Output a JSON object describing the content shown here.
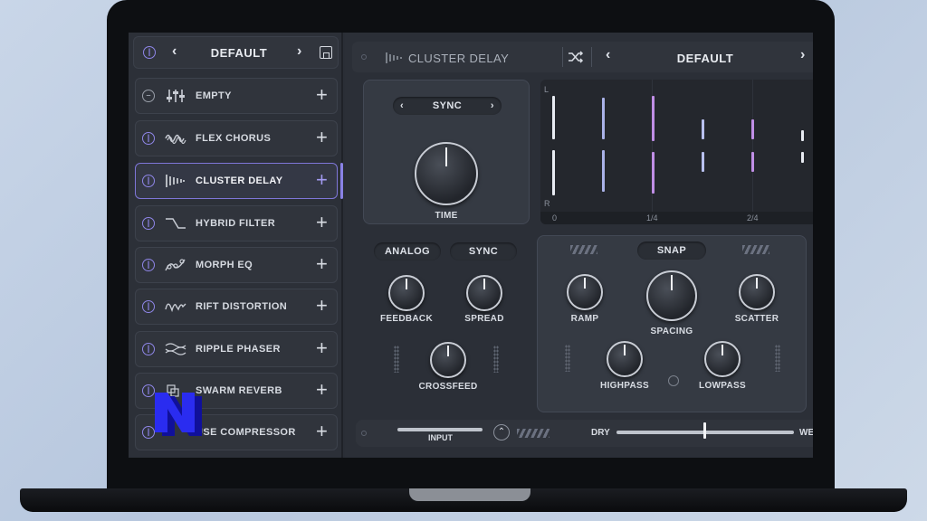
{
  "sidebar": {
    "header": {
      "title": "DEFAULT"
    },
    "items": [
      {
        "label": "EMPTY",
        "icon": "sliders-icon"
      },
      {
        "label": "FLEX CHORUS",
        "icon": "chorus-wave-icon"
      },
      {
        "label": "CLUSTER DELAY",
        "icon": "cluster-delay-icon",
        "active": true
      },
      {
        "label": "HYBRID FILTER",
        "icon": "filter-curve-icon"
      },
      {
        "label": "MORPH EQ",
        "icon": "eq-nodes-icon"
      },
      {
        "label": "RIFT DISTORTION",
        "icon": "distortion-wave-icon"
      },
      {
        "label": "RIPPLE PHASER",
        "icon": "phaser-icon"
      },
      {
        "label": "SWARM REVERB",
        "icon": "reverb-icon"
      },
      {
        "label": "USE COMPRESSOR",
        "icon": "compressor-icon"
      }
    ]
  },
  "topbar": {
    "plugin_name": "CLUSTER DELAY",
    "preset": "DEFAULT"
  },
  "time_panel": {
    "mode": "SYNC",
    "knob_label": "TIME"
  },
  "display": {
    "channel_top": "L",
    "channel_bottom": "R",
    "x_labels": [
      "0",
      "1/4",
      "2/4"
    ]
  },
  "left_controls": {
    "analog": "ANALOG",
    "sync": "SYNC",
    "feedback": "FEEDBACK",
    "spread": "SPREAD",
    "crossfeed": "CROSSFEED"
  },
  "right_controls": {
    "snap": "SNAP",
    "ramp": "RAMP",
    "spacing": "SPACING",
    "scatter": "SCATTER",
    "highpass": "HIGHPASS",
    "lowpass": "LOWPASS"
  },
  "bottom": {
    "input": "INPUT",
    "dry": "DRY",
    "wet": "WE"
  },
  "colors": {
    "accent": "#8f86e8",
    "tap_purple": "#b48ee6",
    "tap_white": "#e8ebf2"
  }
}
